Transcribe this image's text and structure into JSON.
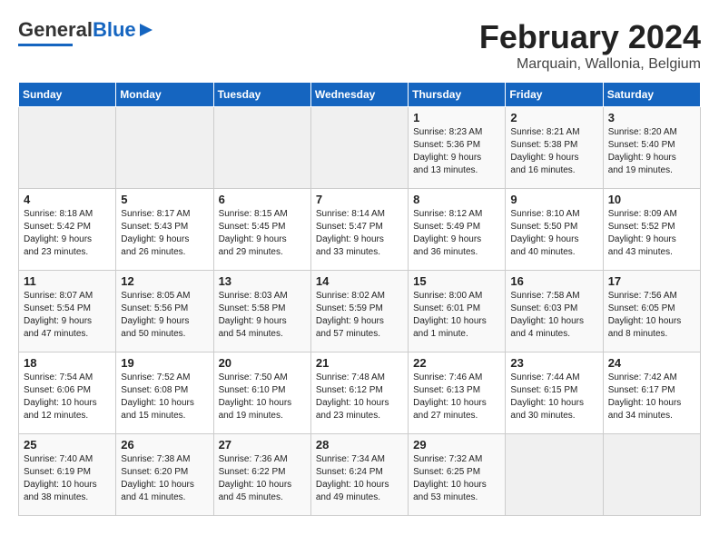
{
  "header": {
    "logo_general": "General",
    "logo_blue": "Blue",
    "title": "February 2024",
    "location": "Marquain, Wallonia, Belgium"
  },
  "days_of_week": [
    "Sunday",
    "Monday",
    "Tuesday",
    "Wednesday",
    "Thursday",
    "Friday",
    "Saturday"
  ],
  "weeks": [
    [
      {
        "day": "",
        "info": ""
      },
      {
        "day": "",
        "info": ""
      },
      {
        "day": "",
        "info": ""
      },
      {
        "day": "",
        "info": ""
      },
      {
        "day": "1",
        "info": "Sunrise: 8:23 AM\nSunset: 5:36 PM\nDaylight: 9 hours\nand 13 minutes."
      },
      {
        "day": "2",
        "info": "Sunrise: 8:21 AM\nSunset: 5:38 PM\nDaylight: 9 hours\nand 16 minutes."
      },
      {
        "day": "3",
        "info": "Sunrise: 8:20 AM\nSunset: 5:40 PM\nDaylight: 9 hours\nand 19 minutes."
      }
    ],
    [
      {
        "day": "4",
        "info": "Sunrise: 8:18 AM\nSunset: 5:42 PM\nDaylight: 9 hours\nand 23 minutes."
      },
      {
        "day": "5",
        "info": "Sunrise: 8:17 AM\nSunset: 5:43 PM\nDaylight: 9 hours\nand 26 minutes."
      },
      {
        "day": "6",
        "info": "Sunrise: 8:15 AM\nSunset: 5:45 PM\nDaylight: 9 hours\nand 29 minutes."
      },
      {
        "day": "7",
        "info": "Sunrise: 8:14 AM\nSunset: 5:47 PM\nDaylight: 9 hours\nand 33 minutes."
      },
      {
        "day": "8",
        "info": "Sunrise: 8:12 AM\nSunset: 5:49 PM\nDaylight: 9 hours\nand 36 minutes."
      },
      {
        "day": "9",
        "info": "Sunrise: 8:10 AM\nSunset: 5:50 PM\nDaylight: 9 hours\nand 40 minutes."
      },
      {
        "day": "10",
        "info": "Sunrise: 8:09 AM\nSunset: 5:52 PM\nDaylight: 9 hours\nand 43 minutes."
      }
    ],
    [
      {
        "day": "11",
        "info": "Sunrise: 8:07 AM\nSunset: 5:54 PM\nDaylight: 9 hours\nand 47 minutes."
      },
      {
        "day": "12",
        "info": "Sunrise: 8:05 AM\nSunset: 5:56 PM\nDaylight: 9 hours\nand 50 minutes."
      },
      {
        "day": "13",
        "info": "Sunrise: 8:03 AM\nSunset: 5:58 PM\nDaylight: 9 hours\nand 54 minutes."
      },
      {
        "day": "14",
        "info": "Sunrise: 8:02 AM\nSunset: 5:59 PM\nDaylight: 9 hours\nand 57 minutes."
      },
      {
        "day": "15",
        "info": "Sunrise: 8:00 AM\nSunset: 6:01 PM\nDaylight: 10 hours\nand 1 minute."
      },
      {
        "day": "16",
        "info": "Sunrise: 7:58 AM\nSunset: 6:03 PM\nDaylight: 10 hours\nand 4 minutes."
      },
      {
        "day": "17",
        "info": "Sunrise: 7:56 AM\nSunset: 6:05 PM\nDaylight: 10 hours\nand 8 minutes."
      }
    ],
    [
      {
        "day": "18",
        "info": "Sunrise: 7:54 AM\nSunset: 6:06 PM\nDaylight: 10 hours\nand 12 minutes."
      },
      {
        "day": "19",
        "info": "Sunrise: 7:52 AM\nSunset: 6:08 PM\nDaylight: 10 hours\nand 15 minutes."
      },
      {
        "day": "20",
        "info": "Sunrise: 7:50 AM\nSunset: 6:10 PM\nDaylight: 10 hours\nand 19 minutes."
      },
      {
        "day": "21",
        "info": "Sunrise: 7:48 AM\nSunset: 6:12 PM\nDaylight: 10 hours\nand 23 minutes."
      },
      {
        "day": "22",
        "info": "Sunrise: 7:46 AM\nSunset: 6:13 PM\nDaylight: 10 hours\nand 27 minutes."
      },
      {
        "day": "23",
        "info": "Sunrise: 7:44 AM\nSunset: 6:15 PM\nDaylight: 10 hours\nand 30 minutes."
      },
      {
        "day": "24",
        "info": "Sunrise: 7:42 AM\nSunset: 6:17 PM\nDaylight: 10 hours\nand 34 minutes."
      }
    ],
    [
      {
        "day": "25",
        "info": "Sunrise: 7:40 AM\nSunset: 6:19 PM\nDaylight: 10 hours\nand 38 minutes."
      },
      {
        "day": "26",
        "info": "Sunrise: 7:38 AM\nSunset: 6:20 PM\nDaylight: 10 hours\nand 41 minutes."
      },
      {
        "day": "27",
        "info": "Sunrise: 7:36 AM\nSunset: 6:22 PM\nDaylight: 10 hours\nand 45 minutes."
      },
      {
        "day": "28",
        "info": "Sunrise: 7:34 AM\nSunset: 6:24 PM\nDaylight: 10 hours\nand 49 minutes."
      },
      {
        "day": "29",
        "info": "Sunrise: 7:32 AM\nSunset: 6:25 PM\nDaylight: 10 hours\nand 53 minutes."
      },
      {
        "day": "",
        "info": ""
      },
      {
        "day": "",
        "info": ""
      }
    ]
  ]
}
